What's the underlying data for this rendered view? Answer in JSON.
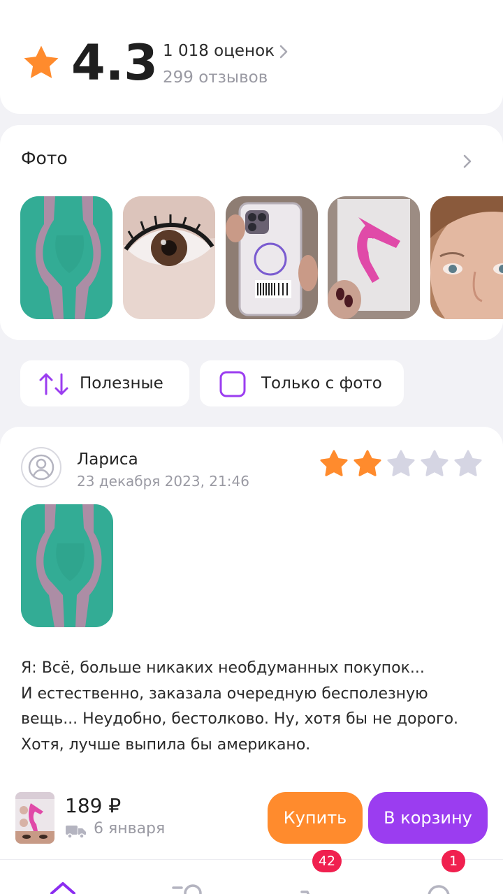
{
  "rating": {
    "value": "4.3",
    "ratings_count": "1 018 оценок",
    "reviews_count": "299 отзывов"
  },
  "photos": {
    "title": "Фото"
  },
  "filters": {
    "sort_label": "Полезные",
    "only_photo_label": "Только с фото",
    "only_photo_checked": false
  },
  "review": {
    "author": "Лариса",
    "date": "23 декабря 2023, 21:46",
    "rating": 2,
    "rating_max": 5,
    "lines": [
      "Я: Всё, больше никаких необдуманных покупок...",
      "И естественно, заказала очередную бесполезную",
      "вещь... Неудобно, бестолково. Ну, хотя бы не дорого.",
      "Хотя, лучше выпила бы американо."
    ]
  },
  "buy_bar": {
    "price": "189 ₽",
    "delivery": "6 января",
    "buy_label": "Купить",
    "cart_label": "В корзину"
  },
  "nav": {
    "cart_badge": "42",
    "profile_badge": "1"
  },
  "colors": {
    "accent_orange": "#ff8b2d",
    "accent_purple": "#9b3df0",
    "badge_red": "#f0204f",
    "star_gray": "#d5d5e3"
  }
}
